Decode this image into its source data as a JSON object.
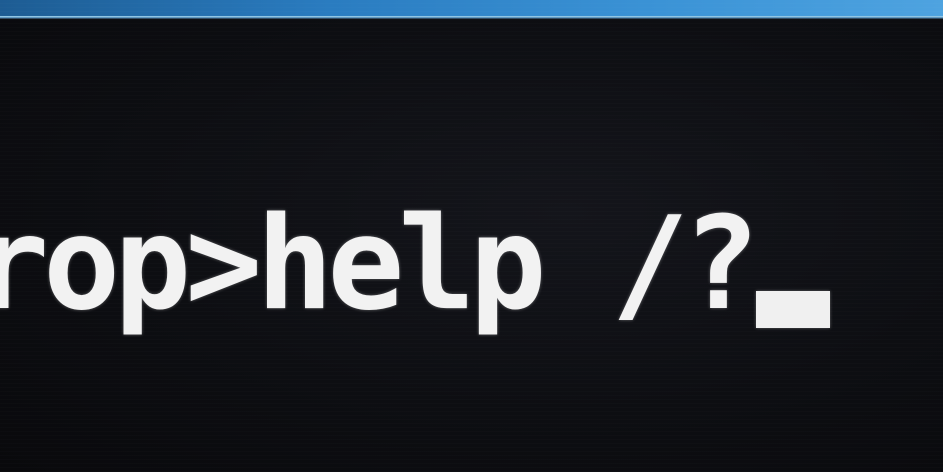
{
  "window": {
    "title_bar_color": "#2a7cc0"
  },
  "console": {
    "background_color": "#0c0c10",
    "text_color": "#f2f2f2",
    "prompt_line": "rop>help /?",
    "cursor": "block"
  }
}
